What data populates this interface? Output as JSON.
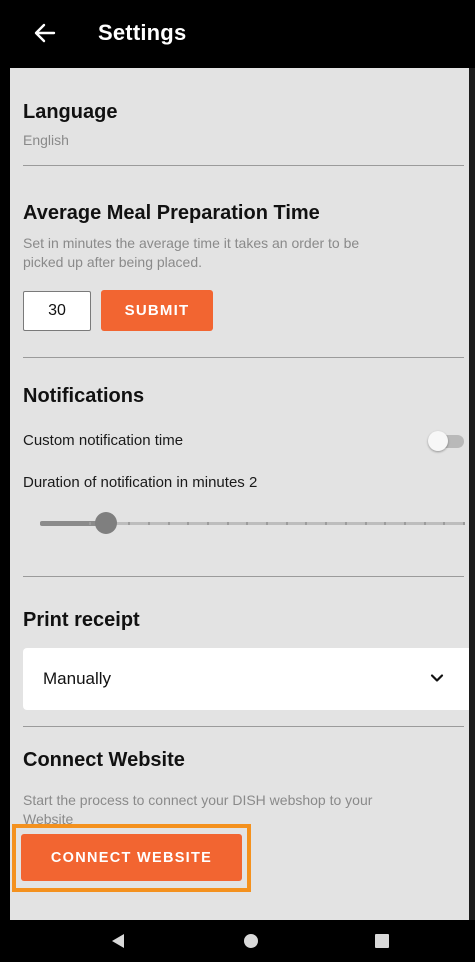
{
  "app_bar": {
    "title": "Settings",
    "back_icon": "arrow-left-icon"
  },
  "language": {
    "title": "Language",
    "value": "English"
  },
  "meal_prep": {
    "title": "Average Meal Preparation Time",
    "description_line1": "Set in minutes the average time it takes an order to be",
    "description_line2": "picked up after being placed.",
    "minutes_value": "30",
    "submit_label": "SUBMIT"
  },
  "notifications": {
    "title": "Notifications",
    "custom_time_label": "Custom notification time",
    "custom_time_enabled": false,
    "duration_label": "Duration of notification in minutes 2",
    "duration_slider": {
      "min": 0,
      "max": 20,
      "value": 2,
      "ticks": 20
    }
  },
  "print_receipt": {
    "title": "Print receipt",
    "selected": "Manually",
    "chevron_icon": "chevron-down-icon"
  },
  "connect_website": {
    "title": "Connect Website",
    "description_line1": "Start the process to connect your DISH webshop to your",
    "description_line2": "Website",
    "button_label": "CONNECT WEBSITE",
    "highlight_color": "#f4911e"
  },
  "colors": {
    "accent": "#f26531",
    "background": "#e3e3e3",
    "bar": "#000000"
  },
  "nav_bar": {
    "back_icon": "triangle-back-icon",
    "home_icon": "circle-home-icon",
    "recents_icon": "square-recents-icon"
  }
}
